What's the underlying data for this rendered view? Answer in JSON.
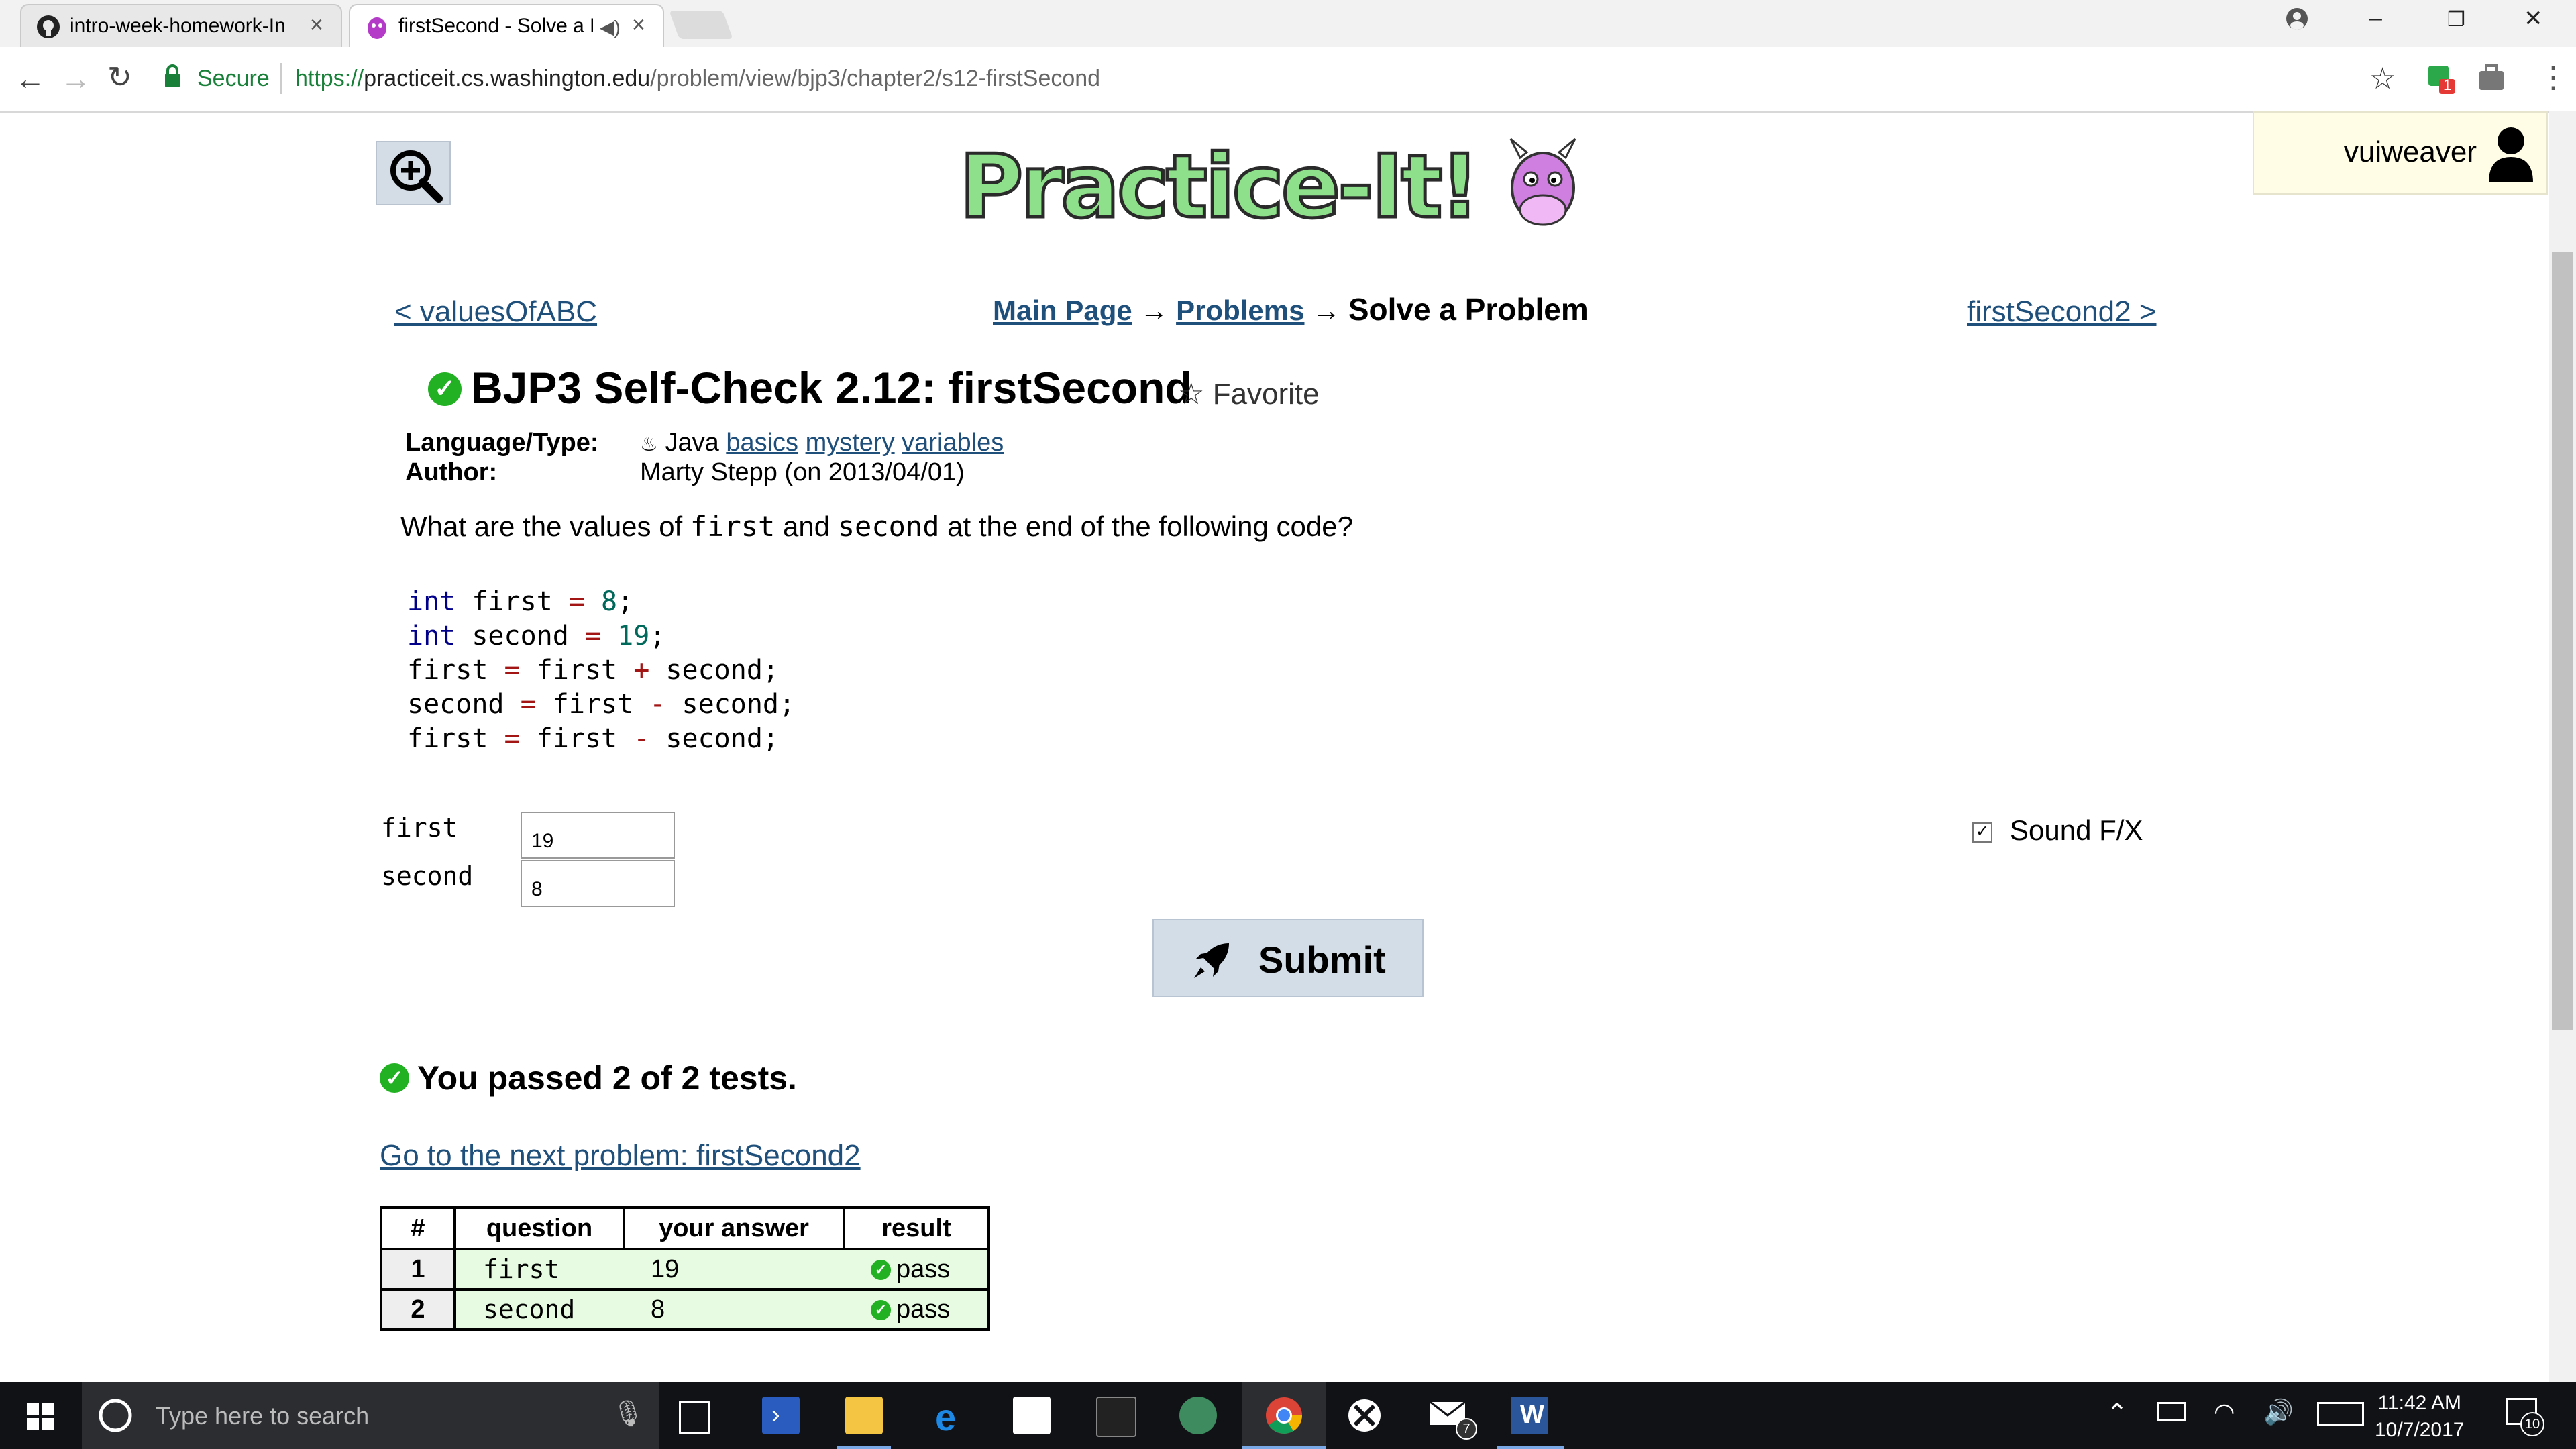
{
  "browser": {
    "tabs": [
      {
        "title": "intro-week-homework-In",
        "active": false
      },
      {
        "title": "firstSecond - Solve a P",
        "active": true
      }
    ],
    "secure_label": "Secure",
    "url_scheme": "https://",
    "url_host": "practiceit.cs.washington.edu",
    "url_path": "/problem/view/bjp3/chapter2/s12-firstSecond",
    "extension_badge": "1"
  },
  "header": {
    "logo_text": "Practice-It!",
    "username": "vuiweaver"
  },
  "nav": {
    "prev_link": "< valuesOfABC",
    "next_link": "firstSecond2 >",
    "breadcrumb": {
      "main": "Main Page",
      "arrow": "→",
      "problems": "Problems",
      "current": "Solve a Problem"
    }
  },
  "problem": {
    "title": "BJP3 Self-Check 2.12: firstSecond",
    "favorite_label": "Favorite",
    "language_key": "Language/Type:",
    "language_value": "Java",
    "tags": [
      "basics",
      "mystery",
      "variables"
    ],
    "author_key": "Author:",
    "author_value": "Marty Stepp (on 2013/04/01)",
    "question_parts": [
      "What are the values of ",
      "first",
      " and ",
      "second",
      " at the end of the following code?"
    ]
  },
  "code": {
    "lines": [
      [
        [
          "kw",
          "int"
        ],
        [
          "",
          "first "
        ],
        [
          "op",
          "="
        ],
        [
          "",
          ""
        ],
        [
          "num",
          " 8"
        ],
        [
          "",
          ";"
        ]
      ],
      [
        [
          "kw",
          "int"
        ],
        [
          "",
          "second "
        ],
        [
          "op",
          "="
        ],
        [
          "",
          ""
        ],
        [
          "num",
          " 19"
        ],
        [
          "",
          ";"
        ]
      ],
      [
        [
          "",
          "first "
        ],
        [
          "op",
          "="
        ],
        [
          "",
          ""
        ],
        [
          "",
          ""
        ],
        [
          "",
          ""
        ],
        [
          "",
          ""
        ]
      ],
      [
        [
          "",
          "second "
        ],
        [
          "op",
          "="
        ],
        [
          "",
          ""
        ],
        [
          "",
          ""
        ],
        [
          "",
          ""
        ],
        [
          "",
          ""
        ]
      ],
      [
        [
          "",
          "first "
        ],
        [
          "op",
          "="
        ],
        [
          "",
          ""
        ],
        [
          "",
          ""
        ],
        [
          "",
          ""
        ],
        [
          "",
          ""
        ]
      ]
    ],
    "raw": [
      "int first = 8;",
      "int second = 19;",
      "first = first + second;",
      "second = first - second;",
      "first = first - second;"
    ]
  },
  "form": {
    "fields": [
      {
        "label": "first",
        "value": "19"
      },
      {
        "label": "second",
        "value": "8"
      }
    ],
    "sound_fx_label": "Sound F/X",
    "sound_fx_checked": true,
    "submit_label": "Submit"
  },
  "results": {
    "summary": "You passed 2 of 2 tests.",
    "next_problem_link": "Go to the next problem: firstSecond2",
    "headers": [
      "#",
      "question",
      "your answer",
      "result"
    ],
    "rows": [
      {
        "n": "1",
        "question": "first",
        "answer": "19",
        "result": "pass"
      },
      {
        "n": "2",
        "question": "second",
        "answer": "8",
        "result": "pass"
      }
    ]
  },
  "taskbar": {
    "search_placeholder": "Type here to search",
    "time": "11:42 AM",
    "date": "10/7/2017",
    "mail_badge": "7",
    "notification_count": "10"
  },
  "colors": {
    "link": "#1f4f7b",
    "pass_green": "#22b122",
    "submit_bg": "#d3dde8",
    "result_row_bg": "#e6fbe1",
    "user_box_bg": "#fffde6"
  }
}
